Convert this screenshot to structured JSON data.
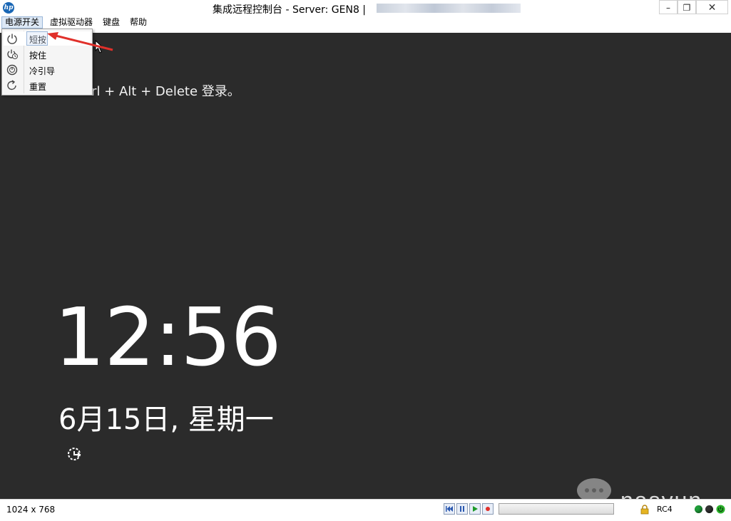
{
  "window": {
    "app_icon": "hp-logo-icon",
    "title": "集成远程控制台 - Server: GEN8 |",
    "minimize": "–",
    "restore": "❐",
    "close": "✕"
  },
  "menu": {
    "items": [
      {
        "label": "电源开关",
        "active": true
      },
      {
        "label": "虚拟驱动器"
      },
      {
        "label": "键盘"
      },
      {
        "label": "帮助"
      }
    ]
  },
  "power_menu": {
    "items": [
      {
        "label": "短按",
        "icon": "power-icon",
        "highlighted": true
      },
      {
        "label": "按住",
        "icon": "power-hold-icon"
      },
      {
        "label": "冷引导",
        "icon": "cold-boot-icon"
      },
      {
        "label": "重置",
        "icon": "reset-icon"
      }
    ]
  },
  "screen": {
    "login_hint": "trl + Alt + Delete 登录。",
    "time": "12:56",
    "date": "6月15日, 星期一",
    "ease_icon": "ease-of-access-icon",
    "background": "#2b2b2b"
  },
  "status": {
    "resolution": "1024 x 768",
    "controls": [
      "skip-back-icon",
      "pause-icon",
      "play-icon",
      "record-icon"
    ],
    "encryption": "RC4",
    "leds": [
      "#1f9e3a",
      "#333333",
      "#2bb12b"
    ],
    "watermark": "nasyun"
  },
  "colors": {
    "arrow": "#e0302a"
  }
}
